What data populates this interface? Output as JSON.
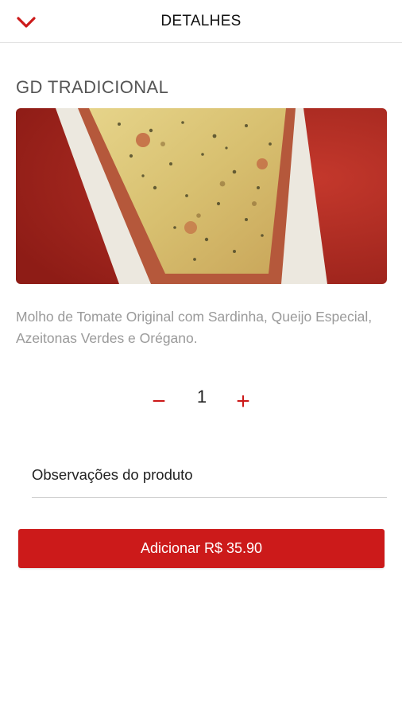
{
  "header": {
    "title": "DETALHES",
    "back_icon": "chevron-down-icon"
  },
  "product": {
    "name": "GD TRADICIONAL",
    "image_alt": "pizza-slice-photo",
    "description": "Molho de Tomate Original com Sardinha, Queijo Especial, Azeitonas Verdes e Orégano."
  },
  "quantity": {
    "minus_symbol": "−",
    "value": "1",
    "plus_symbol": "+"
  },
  "notes": {
    "placeholder": "Observações do produto",
    "value": ""
  },
  "add_button": {
    "label": "Adicionar R$ 35.90"
  },
  "colors": {
    "accent": "#cc1a1a",
    "muted_text": "#9a9a9a",
    "title_text": "#555555"
  }
}
